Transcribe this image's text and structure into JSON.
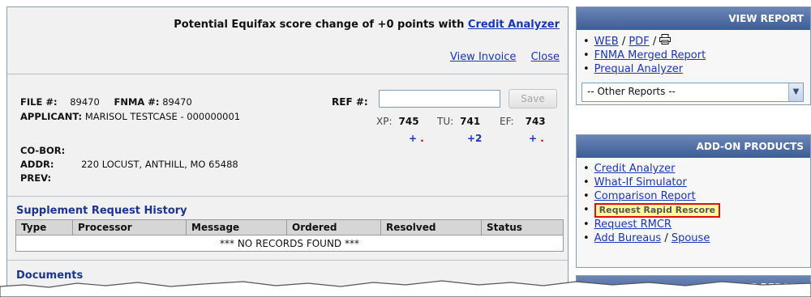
{
  "header": {
    "title_prefix": "Potential Equifax score change of +0 points with",
    "credit_analyzer_link": "Credit Analyzer",
    "view_invoice": "View Invoice",
    "close": "Close"
  },
  "file_info": {
    "file_label": "FILE #:",
    "file_value": "89470",
    "fnma_label": "FNMA #:",
    "fnma_value": "89470",
    "applicant_label": "APPLICANT:",
    "applicant_value": "MARISOL TESTCASE - 000000001",
    "ref_label": "REF #:",
    "ref_value": "",
    "save_label": "Save",
    "cobor_label": "CO-BOR:",
    "addr_label": "ADDR:",
    "addr_value": "220 LOCUST, ANTHILL, MO 65488",
    "prev_label": "PREV:"
  },
  "scores": {
    "xp_label": "XP:",
    "xp_value": "745",
    "xp_change": "+",
    "tu_label": "TU:",
    "tu_value": "741",
    "tu_change": "+2",
    "ef_label": "EF:",
    "ef_value": "743",
    "ef_change": "+",
    "change_dot": "."
  },
  "supplement": {
    "title": "Supplement Request History",
    "columns": [
      "Type",
      "Processor",
      "Message",
      "Ordered",
      "Resolved",
      "Status"
    ],
    "empty_message": "*** NO RECORDS FOUND ***"
  },
  "documents": {
    "title": "Documents"
  },
  "view_report": {
    "header": "VIEW REPORT",
    "web": "WEB",
    "pdf": "PDF",
    "sep": "/",
    "fnma_merged": "FNMA Merged Report",
    "prequal": "Prequal Analyzer",
    "other_reports": "-- Other Reports --"
  },
  "addon": {
    "header": "ADD-ON PRODUCTS",
    "items": {
      "credit_analyzer": "Credit Analyzer",
      "what_if": "What-If Simulator",
      "comparison": "Comparison Report",
      "rapid_rescore": "Request Rapid Rescore",
      "rmcr": "Request RMCR",
      "add_bureaus": "Add Bureaus",
      "sep": "/",
      "spouse": "Spouse"
    }
  },
  "unmerge": {
    "header": "UNMERGE REPORT"
  },
  "colors": {
    "link": "#1a35b8",
    "header_blue": "#3d5d96",
    "highlight": "#ffff99",
    "highlight_border": "#e01010"
  }
}
